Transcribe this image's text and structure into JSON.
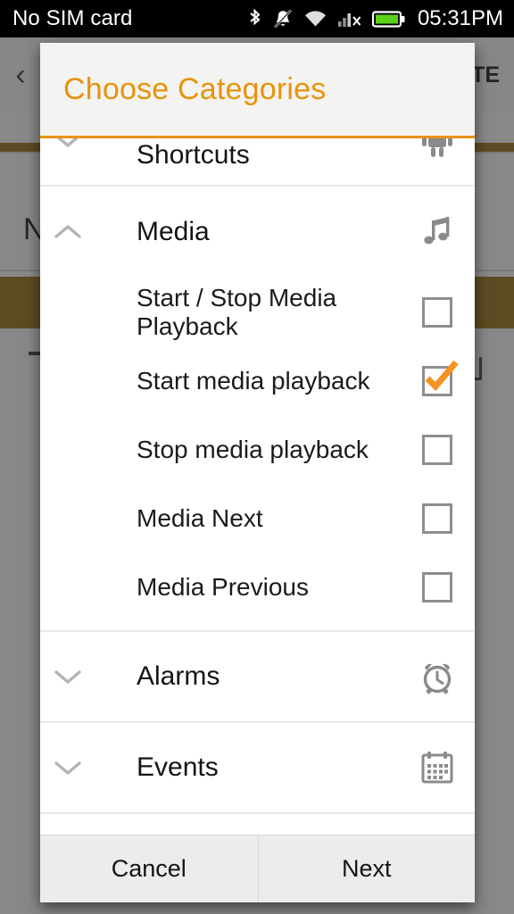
{
  "statusbar": {
    "carrier": "No SIM card",
    "time": "05:31PM",
    "icons": [
      "bluetooth-icon",
      "notifications-muted-icon",
      "wifi-icon",
      "cellular-no-service-icon",
      "battery-icon"
    ]
  },
  "background_app": {
    "back_label": "‹",
    "logo_name": "app-logo-icon",
    "action_text": "TE",
    "row_text": "N"
  },
  "dialog": {
    "title": "Choose Categories",
    "accent_color": "#E8930C",
    "categories": [
      {
        "label": "Applications & Shortcuts",
        "icon": "android-robot-icon",
        "expanded": false,
        "chevron": "chevron-down-icon",
        "items": []
      },
      {
        "label": "Media",
        "icon": "music-note-icon",
        "expanded": true,
        "chevron": "chevron-up-icon",
        "items": [
          {
            "label": "Start / Stop Media Playback",
            "checked": false
          },
          {
            "label": "Start media playback",
            "checked": true
          },
          {
            "label": "Stop media playback",
            "checked": false
          },
          {
            "label": "Media Next",
            "checked": false
          },
          {
            "label": "Media Previous",
            "checked": false
          }
        ]
      },
      {
        "label": "Alarms",
        "icon": "alarm-clock-icon",
        "expanded": false,
        "chevron": "chevron-down-icon",
        "items": []
      },
      {
        "label": "Events",
        "icon": "calendar-icon",
        "expanded": false,
        "chevron": "chevron-down-icon",
        "items": []
      }
    ],
    "buttons": {
      "cancel": "Cancel",
      "next": "Next"
    }
  }
}
